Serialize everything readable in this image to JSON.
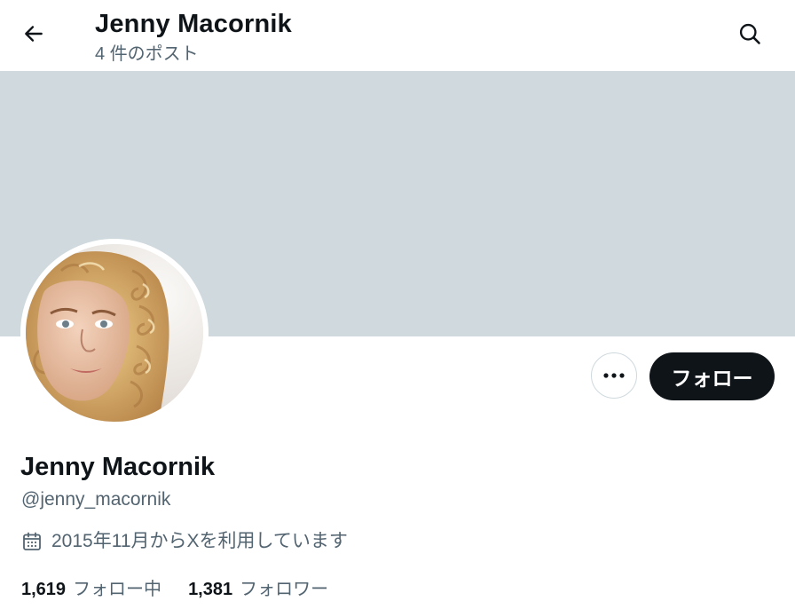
{
  "header": {
    "name": "Jenny Macornik",
    "post_count": "4 件のポスト"
  },
  "icons": {
    "back": "arrow-left-icon",
    "search": "search-icon",
    "more": "more-horizontal-icon",
    "calendar": "calendar-icon"
  },
  "colors": {
    "banner": "#cfd9de",
    "primary_text": "#0f1419",
    "secondary_text": "#536471",
    "follow_button_bg": "#0f1419"
  },
  "profile": {
    "display_name": "Jenny Macornik",
    "handle": "@jenny_macornik",
    "joined": "2015年11月からXを利用しています",
    "following_count": "1,619",
    "following_label": "フォロー中",
    "followers_count": "1,381",
    "followers_label": "フォロワー"
  },
  "actions": {
    "follow_label": "フォロー"
  }
}
